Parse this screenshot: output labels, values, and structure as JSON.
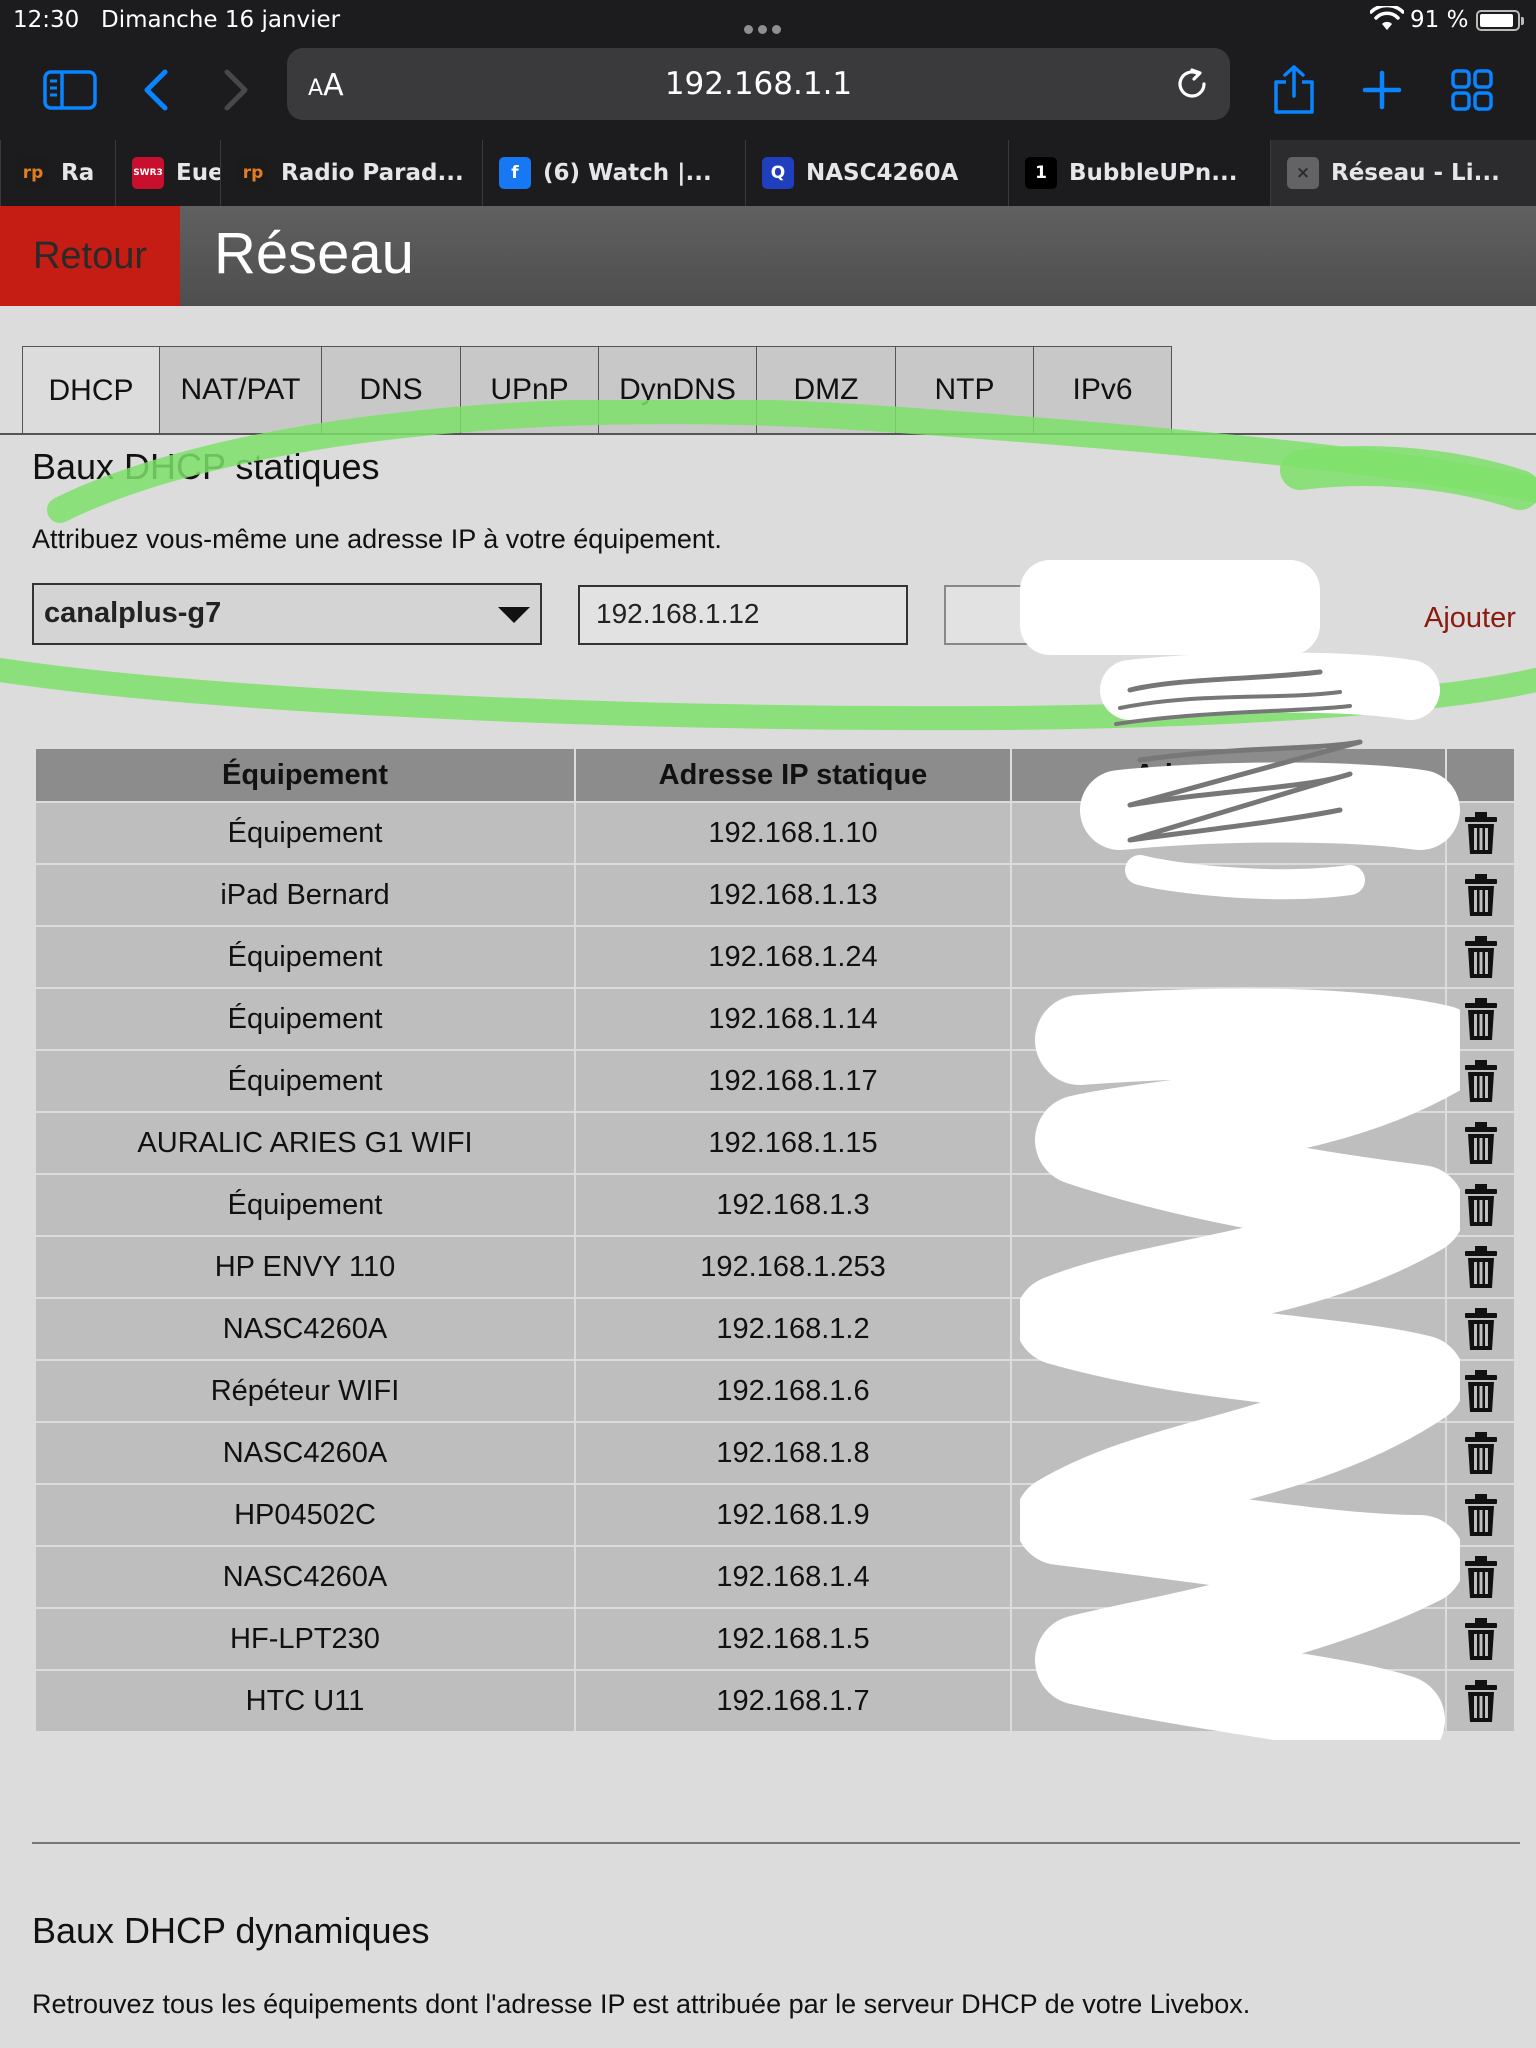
{
  "status_bar": {
    "time": "12:30",
    "date": "Dimanche 16 janvier",
    "battery": "91 %",
    "battery_level": 0.91
  },
  "address_bar": {
    "aa_label_big": "A",
    "aa_label_small": "A",
    "url": "192.168.1.1"
  },
  "browser_tabs": [
    {
      "title": "Ra",
      "favicon_text": "rp",
      "favicon_color": "#1b1b1b",
      "favicon_fg": "#e57c1f"
    },
    {
      "title": "Eue",
      "favicon_text": "SWR3",
      "favicon_color": "#c8102e",
      "favicon_fg": "#ffffff"
    },
    {
      "title": "Radio Parad...",
      "favicon_text": "rp",
      "favicon_color": "#1b1b1b",
      "favicon_fg": "#e57c1f"
    },
    {
      "title": "(6) Watch |...",
      "favicon_text": "f",
      "favicon_color": "#1877f2",
      "favicon_fg": "#ffffff"
    },
    {
      "title": "NASC4260A",
      "favicon_text": "Q",
      "favicon_color": "#1f3fbf",
      "favicon_fg": "#ffffff"
    },
    {
      "title": "BubbleUPn...",
      "favicon_text": "1",
      "favicon_color": "#000000",
      "favicon_fg": "#ffffff"
    },
    {
      "title": "Réseau - Li...",
      "favicon_text": "×",
      "favicon_color": "#636366",
      "favicon_fg": "#2c2c2e"
    }
  ],
  "header": {
    "back_label": "Retour",
    "title": "Réseau"
  },
  "content_tabs": [
    "DHCP",
    "NAT/PAT",
    "DNS",
    "UPnP",
    "DynDNS",
    "DMZ",
    "NTP",
    "IPv6"
  ],
  "static_section": {
    "title": "Baux DHCP statiques",
    "description": "Attribuez vous-même une adresse IP à votre équipement.",
    "selected_device": "canalplus-g7",
    "ip_value": "192.168.1.12",
    "mac_value": "",
    "add_label": "Ajouter"
  },
  "table": {
    "headers": [
      "Équipement",
      "Adresse IP statique",
      "Adresse MAC"
    ],
    "rows": [
      {
        "device": "Équipement",
        "ip": "192.168.1.10"
      },
      {
        "device": "iPad Bernard",
        "ip": "192.168.1.13"
      },
      {
        "device": "Équipement",
        "ip": "192.168.1.24"
      },
      {
        "device": "Équipement",
        "ip": "192.168.1.14"
      },
      {
        "device": "Équipement",
        "ip": "192.168.1.17"
      },
      {
        "device": "AURALIC ARIES G1 WIFI",
        "ip": "192.168.1.15"
      },
      {
        "device": "Équipement",
        "ip": "192.168.1.3"
      },
      {
        "device": "HP ENVY 110",
        "ip": "192.168.1.253"
      },
      {
        "device": "NASC4260A",
        "ip": "192.168.1.2"
      },
      {
        "device": "Répéteur WIFI",
        "ip": "192.168.1.6"
      },
      {
        "device": "NASC4260A",
        "ip": "192.168.1.8"
      },
      {
        "device": "HP04502C",
        "ip": "192.168.1.9"
      },
      {
        "device": "NASC4260A",
        "ip": "192.168.1.4"
      },
      {
        "device": "HF-LPT230",
        "ip": "192.168.1.5"
      },
      {
        "device": "HTC U11",
        "ip": "192.168.1.7"
      }
    ]
  },
  "dynamic_section": {
    "title": "Baux DHCP dynamiques",
    "description": "Retrouvez tous les équipements dont l'adresse IP est attribuée par le serveur DHCP de votre Livebox."
  },
  "colors": {
    "accent_red": "#c51c14",
    "link_red": "#8b1a10",
    "ios_blue": "#0a84ff",
    "highlight_green": "#7ee06a"
  }
}
